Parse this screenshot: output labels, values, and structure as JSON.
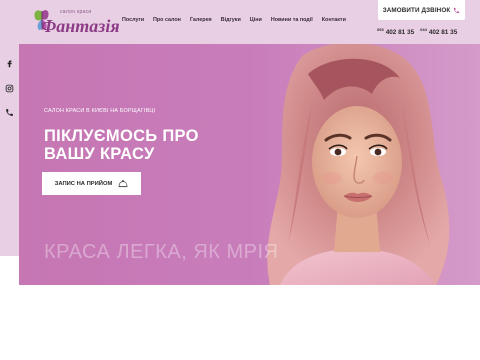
{
  "logo": {
    "small_text": "салон краси",
    "main_text": "Фантазія",
    "icon": "butterfly-icon"
  },
  "nav": {
    "items": [
      {
        "label": "Послуги"
      },
      {
        "label": "Про салон"
      },
      {
        "label": "Галерея"
      },
      {
        "label": "Відгуки"
      },
      {
        "label": "Ціни"
      },
      {
        "label": "Новини та події"
      },
      {
        "label": "Контакти"
      }
    ]
  },
  "header": {
    "call_button_label": "ЗАМОВИТИ ДЗВІНОК",
    "call_icon": "phone-icon",
    "phones": [
      {
        "code": "093",
        "number": "402 81 35"
      },
      {
        "code": "044",
        "number": "402 81 35"
      }
    ]
  },
  "social": {
    "icons": [
      "facebook-icon",
      "instagram-icon",
      "phone-icon"
    ]
  },
  "hero": {
    "subtitle": "САЛОН КРАСИ В КИЄВІ НА БОРЩАГІВЦІ",
    "title": "ПІКЛУЄМОСЬ ПРО ВАШУ КРАСУ",
    "appointment_label": "ЗАПИС НА ПРИЙОМ",
    "appointment_icon": "bell-icon",
    "slogan": "КРАСА ЛЕГКА, ЯК МРІЯ"
  },
  "colors": {
    "brand": "#8c3c87",
    "hero_bg": "#c87dba",
    "top_band": "#e8cfe3"
  }
}
